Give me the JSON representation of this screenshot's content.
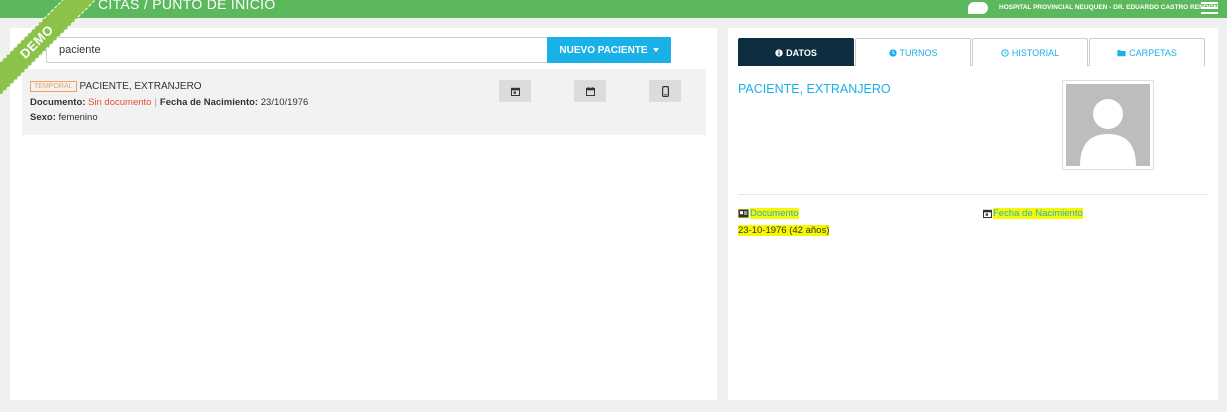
{
  "topbar": {
    "title": "CITAS / PUNTO DE INICIO",
    "hospital": "HOSPITAL PROVINCIAL NEUQUEN - DR. EDUARDO CASTRO RENDON"
  },
  "ribbon": {
    "label": "DEMO"
  },
  "search": {
    "value": "paciente"
  },
  "new_patient_button": "NUEVO PACIENTE",
  "result": {
    "tag": "TEMPORAL",
    "name": "PACIENTE, EXTRANJERO",
    "doc_label": "Documento:",
    "doc_value": "Sin documento",
    "separator": "|",
    "birth_label": "Fecha de Nacimiento:",
    "birth_value": "23/10/1976",
    "sex_label": "Sexo:",
    "sex_value": "femenino"
  },
  "tabs": [
    {
      "label": "DATOS",
      "icon": "info-icon"
    },
    {
      "label": "TURNOS",
      "icon": "clock-icon"
    },
    {
      "label": "HISTORIAL",
      "icon": "history-icon"
    },
    {
      "label": "CARPETAS",
      "icon": "folder-icon"
    }
  ],
  "detail": {
    "name": "PACIENTE, EXTRANJERO",
    "doc_label": "Documento",
    "birth_label": "Fecha de Nacimiento",
    "birth_value": "23-10-1976 (42 años)"
  },
  "colors": {
    "topbar": "#5cb85c",
    "accent": "#1ab0e8",
    "active_tab": "#0d2e3e",
    "warning_red": "#e94b35",
    "highlight": "#f7f700"
  }
}
